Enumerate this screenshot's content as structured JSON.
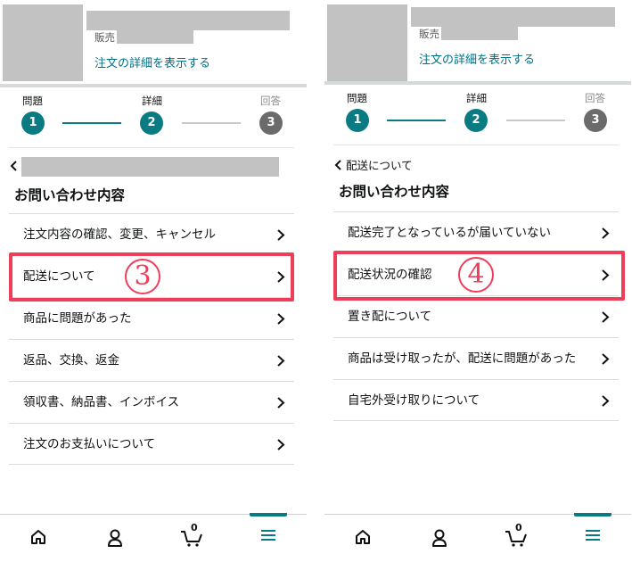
{
  "colors": {
    "teal": "#0a7b83",
    "link": "#007185",
    "highlight": "#ee3e5a",
    "placeholder": "#c2c2c2"
  },
  "left": {
    "order": {
      "seller_label": "販売",
      "details_link": "注文の詳細を表示する"
    },
    "steps": [
      {
        "label": "問題",
        "number": "1",
        "state": "active"
      },
      {
        "label": "詳細",
        "number": "2",
        "state": "active"
      },
      {
        "label": "回答",
        "number": "3",
        "state": "todo"
      }
    ],
    "back_text": "",
    "section_title": "お問い合わせ内容",
    "items": [
      "注文内容の確認、変更、キャンセル",
      "配送について",
      "商品に問題があった",
      "返品、交換、返金",
      "領収書、納品書、インボイス",
      "注文のお支払いについて"
    ],
    "highlighted_index": 1,
    "annotation": "3"
  },
  "right": {
    "order": {
      "seller_label": "販売",
      "details_link": "注文の詳細を表示する"
    },
    "steps": [
      {
        "label": "問題",
        "number": "1",
        "state": "active"
      },
      {
        "label": "詳細",
        "number": "2",
        "state": "active"
      },
      {
        "label": "回答",
        "number": "3",
        "state": "todo"
      }
    ],
    "back_text": "配送について",
    "section_title": "お問い合わせ内容",
    "items": [
      "配送完了となっているが届いていない",
      "配送状況の確認",
      "置き配について",
      "商品は受け取ったが、配送に問題があった",
      "自宅外受け取りについて"
    ],
    "highlighted_index": 1,
    "annotation": "4"
  },
  "bottom_nav": {
    "items": [
      {
        "icon": "home-icon"
      },
      {
        "icon": "account-icon"
      },
      {
        "icon": "cart-icon",
        "count": "0"
      },
      {
        "icon": "menu-icon",
        "active": true
      }
    ]
  }
}
